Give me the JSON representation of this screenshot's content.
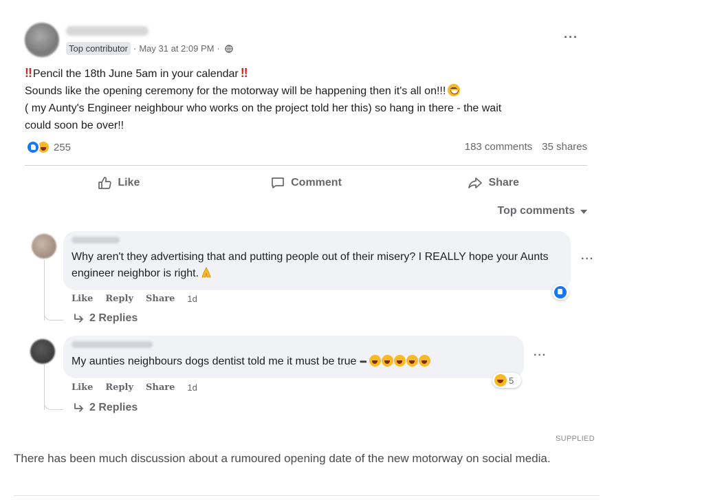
{
  "post": {
    "author_badge": "Top contributor",
    "timestamp": "May 31 at 2:09 PM",
    "meta_separator": "·",
    "more_label": "···",
    "body_line1": "Pencil the 18th June 5am in your calendar",
    "body_line2": "Sounds like the opening ceremony for the motorway will be happening then it's all on!!!",
    "body_line3": "( my Aunty's Engineer neighbour who works on the project told her this) so hang in there - the wait",
    "body_line4": "could soon be over!!",
    "bang_marks": "‼",
    "reaction_count": "255",
    "comments_count": "183 comments",
    "shares_count": "35 shares",
    "reaction_icons": [
      "like-reaction-icon",
      "haha-reaction-icon"
    ]
  },
  "actions": {
    "like_label": "Like",
    "comment_label": "Comment",
    "share_label": "Share"
  },
  "sort": {
    "label": "Top comments"
  },
  "comments": [
    {
      "text": "Why aren't they advertising that and putting people out of their misery? I REALLY hope your Aunts engineer neighbor is right.",
      "like_label": "Like",
      "reply_label": "Reply",
      "share_label": "Share",
      "time": "1d",
      "replies_label": "2 Replies",
      "reaction_icons": [
        "like-reaction-icon"
      ]
    },
    {
      "text": "My aunties neighbours dogs dentist told me it must be true",
      "eyes": "••••",
      "like_label": "Like",
      "reply_label": "Reply",
      "share_label": "Share",
      "time": "1d",
      "replies_label": "2 Replies",
      "reaction_count": "5",
      "reaction_icons": [
        "haha-reaction-icon"
      ]
    }
  ],
  "caption": {
    "credit": "SUPPLIED",
    "text": "There has been much discussion about a rumoured opening date of the new motorway on social media."
  },
  "colors": {
    "facebook_blue": "#1877f2",
    "secondary_text": "#65676b",
    "bubble_bg": "#f0f2f5",
    "emoji_yellow": "#f7b928",
    "alert_red": "#e02020"
  }
}
